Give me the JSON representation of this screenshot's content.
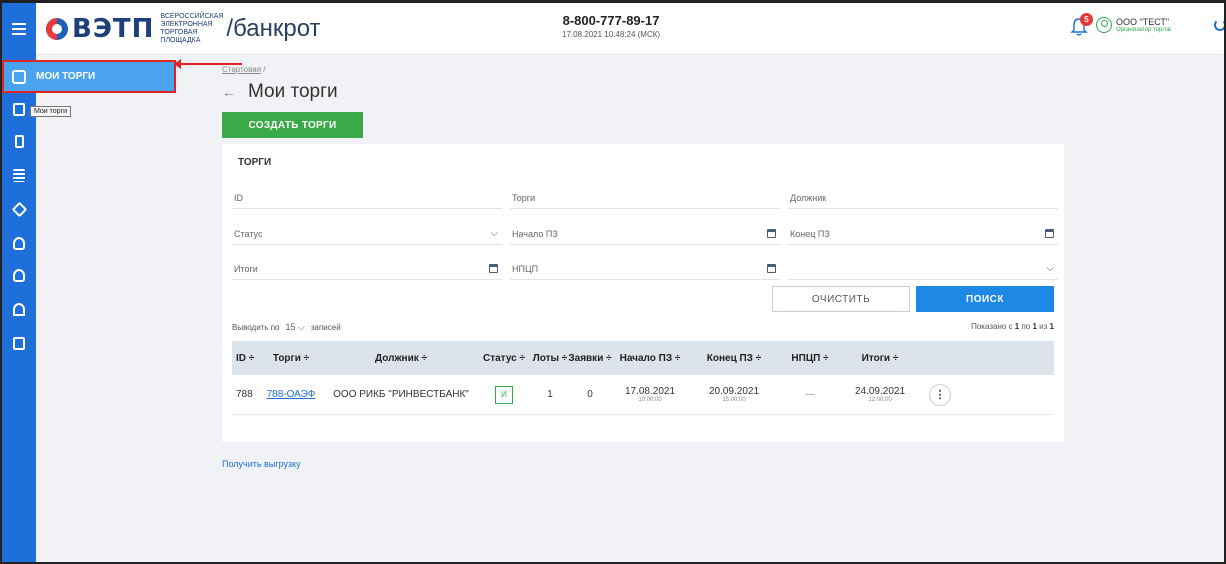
{
  "header": {
    "brand": "ВЭТП",
    "brand_sub": "ВСЕРОССИЙСКАЯ ЭЛЕКТРОННАЯ ТОРГОВАЯ ПЛОЩАДКА",
    "section": "/банкрот",
    "phone": "8-800-777-89-17",
    "datetime": "17.08.2021 10:48:24 (МСК)",
    "notifications": "5",
    "org": "ООО \"ТЕСТ\"",
    "role": "Организатор торгов"
  },
  "sidebar": {
    "active_label": "МОИ ТОРГИ",
    "tooltip": "Мои торги",
    "icons": [
      "document-icon",
      "receipt-icon",
      "list-icon",
      "gavel-icon",
      "auction-icon",
      "auction-alt-icon",
      "house-icon",
      "id-card-icon"
    ]
  },
  "page": {
    "breadcrumb": "Стартовая",
    "breadcrumb_sep": "/",
    "title": "Мои торги",
    "create_button": "СОЗДАТЬ ТОРГИ",
    "card_title": "ТОРГИ",
    "export_link": "Получить выгрузку"
  },
  "filters": {
    "id": "ID",
    "torgi": "Торги",
    "dolzhnik": "Должник",
    "status": "Статус",
    "nachalo": "Начало ПЗ",
    "konec": "Конец ПЗ",
    "itogi": "Итоги",
    "npcp": "НПЦП",
    "empty_select": "",
    "clear": "ОЧИСТИТЬ",
    "search": "ПОИСК"
  },
  "pagination": {
    "prefix": "Выводить по",
    "per_page": "15",
    "suffix": "записей",
    "shown_prefix": "Показано с",
    "from": "1",
    "mid": "по",
    "to": "1",
    "of": "из",
    "total": "1"
  },
  "table": {
    "headers": [
      "ID",
      "Торги",
      "Должник",
      "Статус",
      "Лоты",
      "Заявки",
      "Начало ПЗ",
      "Конец ПЗ",
      "НПЦП",
      "Итоги"
    ],
    "sort_mark": "÷",
    "rows": [
      {
        "id": "788",
        "torgi": "788-ОАЭФ",
        "dolzhnik": "ООО РИКБ \"РИНВЕСТБАНК\"",
        "status": "И",
        "loty": "1",
        "zayavki": "0",
        "nachalo_date": "17.08.2021",
        "nachalo_time": "10:00:00",
        "konec_date": "20.09.2021",
        "konec_time": "15:00:00",
        "npcp": "—",
        "itogi_date": "24.09.2021",
        "itogi_time": "12:00:00"
      }
    ]
  },
  "colors": {
    "sidebar": "#1e6fd9",
    "active_menu": "#4aa3ee",
    "highlight": "#e02424",
    "create_button": "#3aaa48",
    "search_button": "#1e88e5"
  }
}
